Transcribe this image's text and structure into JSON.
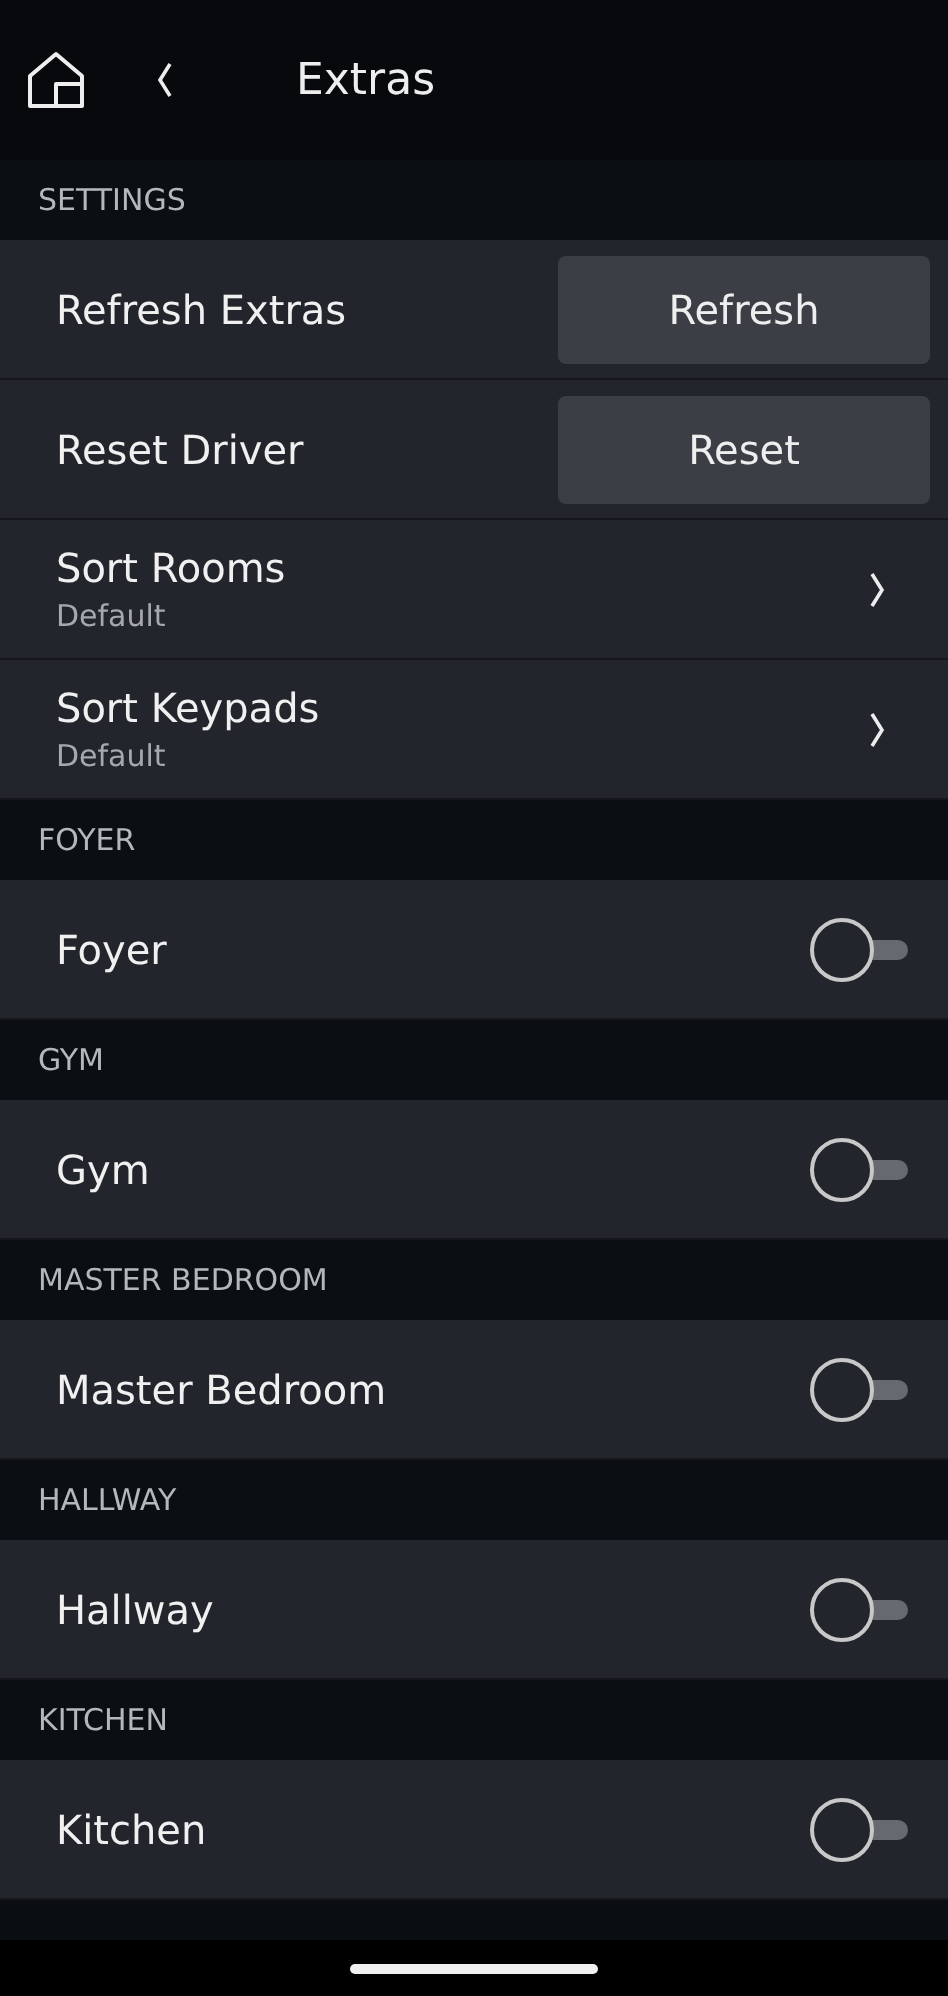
{
  "header": {
    "title": "Extras"
  },
  "sections": [
    {
      "title": "SETTINGS",
      "items": [
        {
          "kind": "button",
          "label": "Refresh Extras",
          "button": "Refresh"
        },
        {
          "kind": "button",
          "label": "Reset Driver",
          "button": "Reset"
        },
        {
          "kind": "nav",
          "label": "Sort Rooms",
          "value": "Default"
        },
        {
          "kind": "nav",
          "label": "Sort Keypads",
          "value": "Default"
        }
      ]
    },
    {
      "title": "FOYER",
      "items": [
        {
          "kind": "toggle",
          "label": "Foyer",
          "on": false
        }
      ]
    },
    {
      "title": "GYM",
      "items": [
        {
          "kind": "toggle",
          "label": "Gym",
          "on": false
        }
      ]
    },
    {
      "title": "MASTER BEDROOM",
      "items": [
        {
          "kind": "toggle",
          "label": "Master Bedroom",
          "on": false
        }
      ]
    },
    {
      "title": "HALLWAY",
      "items": [
        {
          "kind": "toggle",
          "label": "Hallway",
          "on": false
        }
      ]
    },
    {
      "title": "KITCHEN",
      "items": [
        {
          "kind": "toggle",
          "label": "Kitchen",
          "on": false
        }
      ]
    }
  ]
}
